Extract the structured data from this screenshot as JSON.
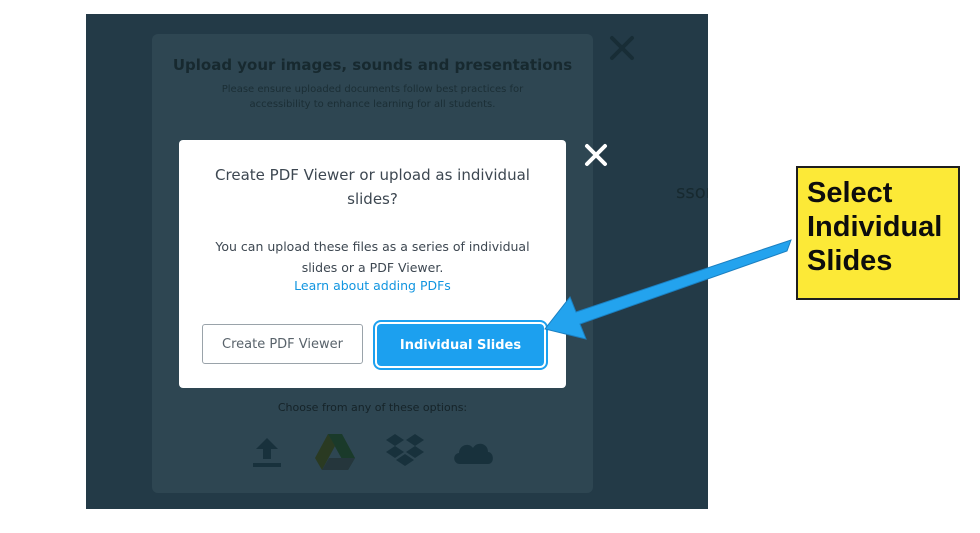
{
  "background": {
    "title": "Upload your images, sounds and presentations",
    "subtitle": "Please ensure uploaded documents follow best practices for accessibility to enhance learning for all students.",
    "choose_text": "Choose from any of these options:",
    "right_fragment": "ssons",
    "icons": [
      "upload-icon",
      "google-drive-icon",
      "dropbox-icon",
      "onedrive-cloud-icon"
    ]
  },
  "dialog": {
    "title": "Create PDF Viewer or upload as individual slides?",
    "body": "You can upload these files as a series of individual slides or a PDF Viewer.",
    "link": "Learn about adding PDFs",
    "pdf_button": "Create PDF Viewer",
    "slides_button": "Individual Slides"
  },
  "callout": {
    "lines": [
      "Select",
      "Individual",
      "Slides"
    ]
  },
  "colors": {
    "overlay": "#233a47",
    "accent": "#1ca0ef",
    "link": "#1195e0",
    "callout_bg": "#fce937"
  }
}
